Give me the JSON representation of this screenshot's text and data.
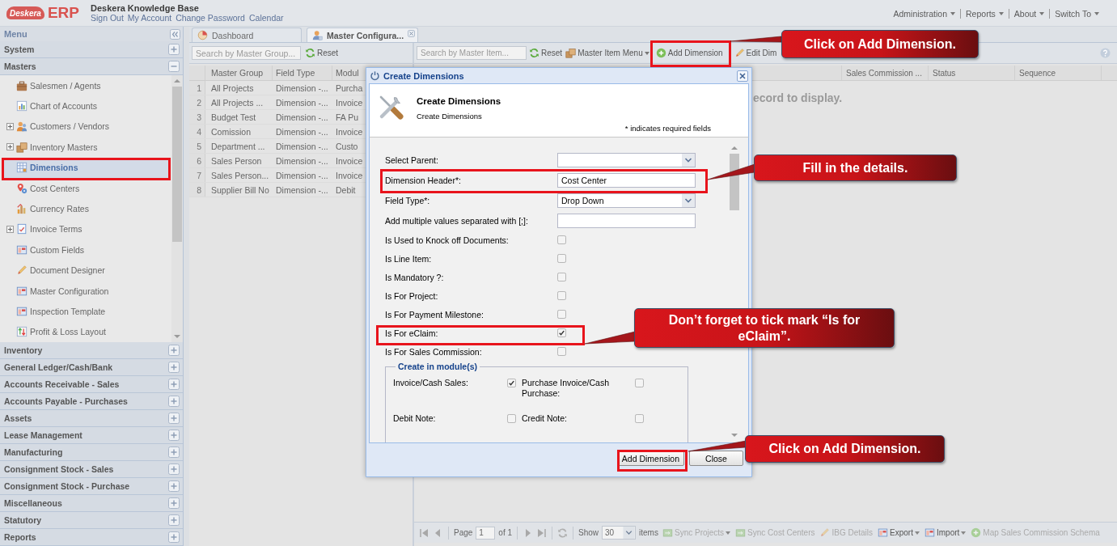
{
  "header": {
    "logo": {
      "brand": "Deskera",
      "product": "ERP"
    },
    "title": "Deskera Knowledge Base",
    "links": [
      "Sign Out",
      "My Account",
      "Change Password",
      "Calendar"
    ],
    "menus": [
      "Administration",
      "Reports",
      "About",
      "Switch To"
    ]
  },
  "sidebar": {
    "title": "Menu",
    "sections": [
      {
        "label": "System",
        "expanded": false
      },
      {
        "label": "Masters",
        "expanded": true,
        "items": [
          {
            "label": "Salesmen / Agents",
            "expandable": false,
            "selected": false
          },
          {
            "label": "Chart of Accounts",
            "expandable": false,
            "selected": false
          },
          {
            "label": "Customers / Vendors",
            "expandable": true,
            "selected": false
          },
          {
            "label": "Inventory Masters",
            "expandable": true,
            "selected": false
          },
          {
            "label": "Dimensions",
            "expandable": false,
            "selected": true
          },
          {
            "label": "Cost Centers",
            "expandable": false,
            "selected": false
          },
          {
            "label": "Currency Rates",
            "expandable": false,
            "selected": false
          },
          {
            "label": "Invoice Terms",
            "expandable": true,
            "selected": false
          },
          {
            "label": "Custom Fields",
            "expandable": false,
            "selected": false
          },
          {
            "label": "Document Designer",
            "expandable": false,
            "selected": false
          },
          {
            "label": "Master Configuration",
            "expandable": false,
            "selected": false
          },
          {
            "label": "Inspection Template",
            "expandable": false,
            "selected": false
          },
          {
            "label": "Profit & Loss Layout",
            "expandable": false,
            "selected": false
          }
        ]
      },
      {
        "label": "Inventory",
        "expanded": false
      },
      {
        "label": "General Ledger/Cash/Bank",
        "expanded": false
      },
      {
        "label": "Accounts Receivable - Sales",
        "expanded": false
      },
      {
        "label": "Accounts Payable - Purchases",
        "expanded": false
      },
      {
        "label": "Assets",
        "expanded": false
      },
      {
        "label": "Lease Management",
        "expanded": false
      },
      {
        "label": "Manufacturing",
        "expanded": false
      },
      {
        "label": "Consignment Stock - Sales",
        "expanded": false
      },
      {
        "label": "Consignment Stock - Purchase",
        "expanded": false
      },
      {
        "label": "Miscellaneous",
        "expanded": false
      },
      {
        "label": "Statutory",
        "expanded": false
      },
      {
        "label": "Reports",
        "expanded": false
      }
    ]
  },
  "tabs": [
    {
      "label": "Dashboard",
      "selected": false,
      "closable": false
    },
    {
      "label": "Master Configura...",
      "selected": true,
      "closable": true
    }
  ],
  "group_panel": {
    "search": {
      "placeholder": "Search by Master Group..."
    },
    "reset": "Reset",
    "columns": [
      "Master Group",
      "Field Type",
      "Modul"
    ],
    "rows": [
      {
        "number": "1",
        "cells": [
          "All Projects",
          "Dimension -...",
          "Purcha"
        ]
      },
      {
        "number": "2",
        "cells": [
          "All Projects ...",
          "Dimension -...",
          "Invoice"
        ]
      },
      {
        "number": "3",
        "cells": [
          "Budget Test",
          "Dimension -...",
          "FA Pu"
        ]
      },
      {
        "number": "4",
        "cells": [
          "Comission",
          "Dimension -...",
          "Invoice"
        ]
      },
      {
        "number": "5",
        "cells": [
          "Department ...",
          "Dimension -...",
          "Custo"
        ]
      },
      {
        "number": "6",
        "cells": [
          "Sales Person",
          "Dimension -...",
          "Invoice"
        ]
      },
      {
        "number": "7",
        "cells": [
          "Sales Person...",
          "Dimension -...",
          "Invoice"
        ]
      },
      {
        "number": "8",
        "cells": [
          "Supplier Bill No",
          "Dimension -...",
          "Debit"
        ]
      }
    ]
  },
  "item_panel": {
    "search": {
      "placeholder": "Search by Master Item..."
    },
    "toolbar": [
      {
        "label": "Reset",
        "dropdown": false
      },
      {
        "label": "Master Item Menu",
        "dropdown": true
      },
      {
        "label": "Add Dimension",
        "dropdown": false
      },
      {
        "label": "Edit Dim",
        "dropdown": false
      }
    ],
    "columns": [
      "Sales Commission ...",
      "Status",
      "Sequence"
    ],
    "empty_text": "ecord to display.",
    "paging": {
      "page_label": "Page",
      "page": "1",
      "page_count": "of 1",
      "show_label": "Show",
      "page_size": "30",
      "items_label": "items"
    },
    "actions": [
      {
        "label": "Sync Projects",
        "dropdown": true,
        "disabled": true
      },
      {
        "label": "Sync Cost Centers",
        "dropdown": false,
        "disabled": true
      },
      {
        "label": "IBG Details",
        "dropdown": false,
        "disabled": true
      },
      {
        "label": "Export",
        "dropdown": true,
        "disabled": false
      },
      {
        "label": "Import",
        "dropdown": true,
        "disabled": false
      },
      {
        "label": "Map Sales Commission Schema",
        "dropdown": false,
        "disabled": true
      }
    ]
  },
  "dialog": {
    "title": "Create Dimensions",
    "heading": "Create Dimensions",
    "subheading": "Create Dimensions",
    "required_note": "* indicates required fields",
    "fields": [
      {
        "kind": "combo",
        "label": "Select Parent:"
      },
      {
        "kind": "text",
        "label": "Dimension Header*:",
        "value": "Cost Center"
      },
      {
        "kind": "combo",
        "label": "Field Type*:",
        "value": "Drop Down"
      },
      {
        "kind": "text",
        "label": "Add multiple values separated with [;]:"
      },
      {
        "kind": "checkbox",
        "label": "Is Used to Knock off Documents:",
        "checked": false
      },
      {
        "kind": "checkbox",
        "label": "Is Line Item:",
        "checked": false
      },
      {
        "kind": "checkbox",
        "label": "Is Mandatory ?:",
        "checked": false
      },
      {
        "kind": "checkbox",
        "label": "Is For Project:",
        "checked": false
      },
      {
        "kind": "checkbox",
        "label": "Is For Payment Milestone:",
        "checked": false
      },
      {
        "kind": "checkbox",
        "label": "Is For eClaim:",
        "checked": true
      },
      {
        "kind": "checkbox",
        "label": "Is For Sales Commission:",
        "checked": false
      }
    ],
    "modules": {
      "title": "Create in module(s)",
      "options": [
        {
          "label": "Invoice/Cash Sales:",
          "checked": true
        },
        {
          "label": "Purchase Invoice/Cash Purchase:",
          "checked": false
        },
        {
          "label": "Debit Note:",
          "checked": false
        },
        {
          "label": "Credit Note:",
          "checked": false
        }
      ]
    },
    "buttons": [
      "Add Dimension",
      "Close"
    ]
  },
  "callouts": [
    {
      "text": "Click on Add Dimension."
    },
    {
      "text": "Fill in the details."
    },
    {
      "text": "Don’t forget to tick mark “Is for eClaim”."
    },
    {
      "text": "Click on Add Dimension."
    }
  ]
}
